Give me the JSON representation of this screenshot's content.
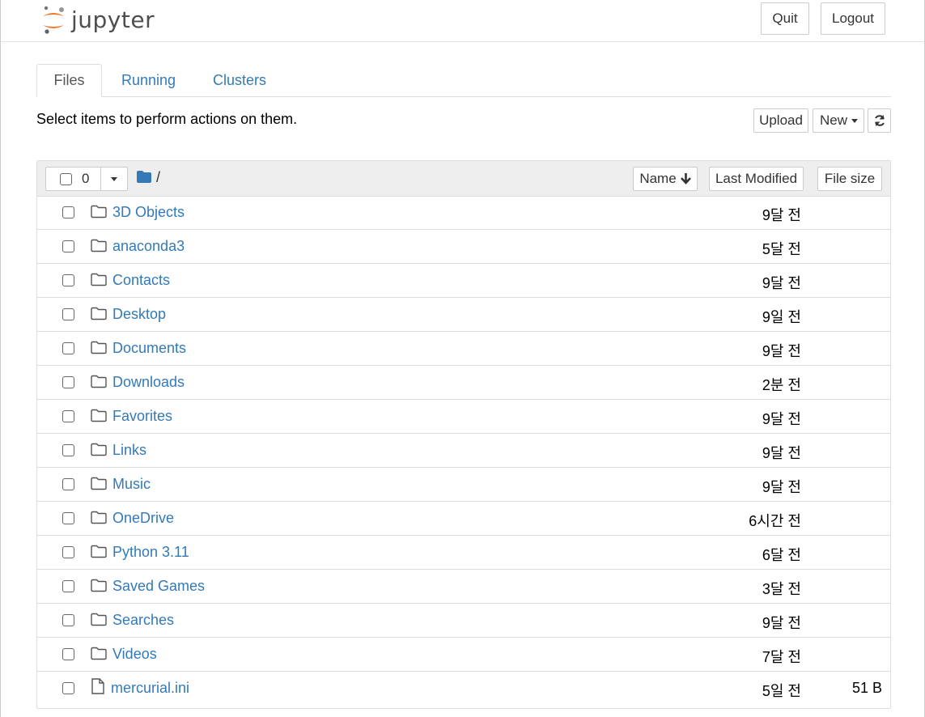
{
  "app": {
    "logo_text": "jupyter"
  },
  "header": {
    "quit_label": "Quit",
    "logout_label": "Logout"
  },
  "tabs": [
    {
      "label": "Files",
      "active": true
    },
    {
      "label": "Running",
      "active": false
    },
    {
      "label": "Clusters",
      "active": false
    }
  ],
  "toolbar": {
    "hint": "Select items to perform actions on them.",
    "upload_label": "Upload",
    "new_label": "New",
    "refresh_icon": "refresh-icon"
  },
  "list_header": {
    "selected_count": "0",
    "path": "/",
    "sort_name": "Name",
    "sort_modified": "Last Modified",
    "sort_size": "File size"
  },
  "items": [
    {
      "name": "3D Objects",
      "type": "folder",
      "modified": "9달 전",
      "size": ""
    },
    {
      "name": "anaconda3",
      "type": "folder",
      "modified": "5달 전",
      "size": ""
    },
    {
      "name": "Contacts",
      "type": "folder",
      "modified": "9달 전",
      "size": ""
    },
    {
      "name": "Desktop",
      "type": "folder",
      "modified": "9일 전",
      "size": ""
    },
    {
      "name": "Documents",
      "type": "folder",
      "modified": "9달 전",
      "size": ""
    },
    {
      "name": "Downloads",
      "type": "folder",
      "modified": "2분 전",
      "size": ""
    },
    {
      "name": "Favorites",
      "type": "folder",
      "modified": "9달 전",
      "size": ""
    },
    {
      "name": "Links",
      "type": "folder",
      "modified": "9달 전",
      "size": ""
    },
    {
      "name": "Music",
      "type": "folder",
      "modified": "9달 전",
      "size": ""
    },
    {
      "name": "OneDrive",
      "type": "folder",
      "modified": "6시간 전",
      "size": ""
    },
    {
      "name": "Python 3.11",
      "type": "folder",
      "modified": "6달 전",
      "size": ""
    },
    {
      "name": "Saved Games",
      "type": "folder",
      "modified": "3달 전",
      "size": ""
    },
    {
      "name": "Searches",
      "type": "folder",
      "modified": "9달 전",
      "size": ""
    },
    {
      "name": "Videos",
      "type": "folder",
      "modified": "7달 전",
      "size": ""
    },
    {
      "name": "mercurial.ini",
      "type": "file",
      "modified": "5일 전",
      "size": "51 B"
    }
  ],
  "colors": {
    "link": "#337ab7",
    "logo_orange": "#f37726",
    "header_bg": "#eeeeee"
  }
}
